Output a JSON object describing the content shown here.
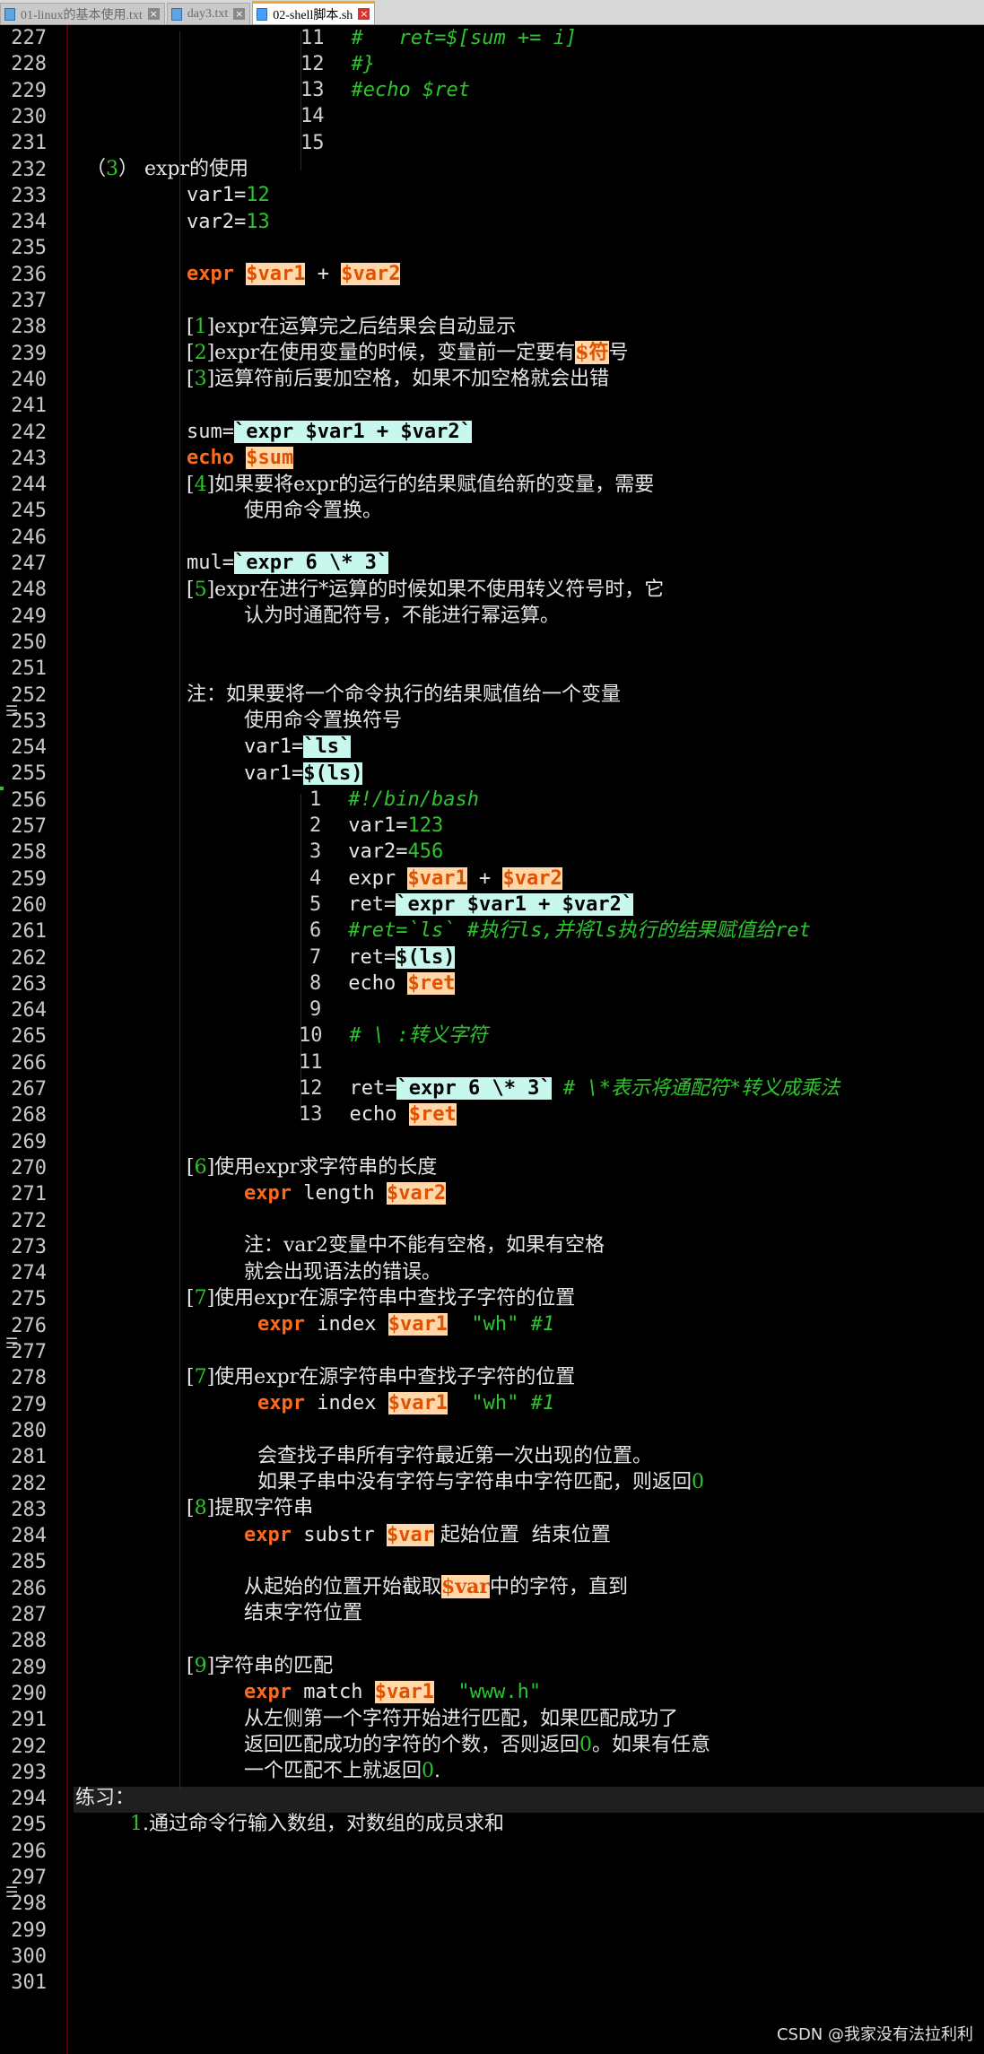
{
  "tabs": [
    {
      "label": "01-linux的基本使用.txt",
      "active": false
    },
    {
      "label": "day3.txt",
      "active": false
    },
    {
      "label": "02-shell脚本.sh",
      "active": true
    }
  ],
  "line_numbers": [
    "227",
    "228",
    "229",
    "230",
    "231",
    "232",
    "233",
    "234",
    "235",
    "236",
    "237",
    "238",
    "239",
    "240",
    "241",
    "242",
    "243",
    "244",
    "245",
    "246",
    "247",
    "248",
    "249",
    "250",
    "251",
    "252",
    "253",
    "254",
    "255",
    "256",
    "257",
    "258",
    "259",
    "260",
    "261",
    "262",
    "263",
    "264",
    "265",
    "266",
    "267",
    "268",
    "269",
    "270",
    "271",
    "272",
    "273",
    "274",
    "275",
    "276",
    "277",
    "278",
    "279",
    "280",
    "281",
    "282",
    "283",
    "284",
    "285",
    "286",
    "287",
    "288",
    "289",
    "290",
    "291",
    "292",
    "293",
    "294",
    "295",
    "296",
    "297",
    "298",
    "299",
    "300",
    "301"
  ],
  "lines": {
    "l227": {
      "n": "11",
      "a": "#   ret=$[sum += i]"
    },
    "l228": {
      "n": "12",
      "a": "#}"
    },
    "l229": {
      "n": "13",
      "a": "#echo $ret"
    },
    "l230": {
      "n": "14"
    },
    "l231": {
      "n": "15"
    },
    "l232": {
      "a": "（",
      "b": "3",
      "c": "） expr的使用"
    },
    "l233": {
      "a": "var1=",
      "b": "12"
    },
    "l234": {
      "a": "var2=",
      "b": "13"
    },
    "l236": {
      "a": "expr",
      "b": "$var1",
      "c": " + ",
      "d": "$var2"
    },
    "l238": {
      "a": "[",
      "b": "1",
      "c": "]expr在运算完之后结果会自动显示"
    },
    "l239": {
      "a": "[",
      "b": "2",
      "c": "]expr在使用变量的时候，变量前一定要有",
      "d": "$符",
      "e": "号"
    },
    "l240": {
      "a": "[",
      "b": "3",
      "c": "]运算符前后要加空格，如果不加空格就会出错"
    },
    "l242": {
      "a": "sum=",
      "b": "`expr $var1 + $var2`"
    },
    "l243": {
      "a": "echo",
      "b": "$sum"
    },
    "l244": {
      "a": "[",
      "b": "4",
      "c": "]如果要将expr的运行的结果赋值给新的变量，需要"
    },
    "l245": {
      "a": "使用命令置换。"
    },
    "l247": {
      "a": "mul=",
      "b": "`expr 6 \\* 3`"
    },
    "l248": {
      "a": "[",
      "b": "5",
      "c": "]expr在进行*运算的时候如果不使用转义符号时，它"
    },
    "l249": {
      "a": "认为时通配符号，不能进行幂运算。"
    },
    "l252": {
      "a": "注：如果要将一个命令执行的结果赋值给一个变量"
    },
    "l253": {
      "a": "使用命令置换符号"
    },
    "l254": {
      "a": "var1=",
      "b": "`ls`"
    },
    "l255": {
      "a": "var1=",
      "b": "$(ls)"
    },
    "l256": {
      "n": "1",
      "a": "#!/bin/bash"
    },
    "l257": {
      "n": "2",
      "a": "var1=",
      "b": "123"
    },
    "l258": {
      "n": "3",
      "a": "var2=",
      "b": "456"
    },
    "l259": {
      "n": "4",
      "a": "expr ",
      "b": "$var1",
      "c": " + ",
      "d": "$var2"
    },
    "l260": {
      "n": "5",
      "a": "ret=",
      "b": "`expr $var1 + $var2`"
    },
    "l261": {
      "n": "6",
      "a": "#ret=`ls` #执行ls,并将ls执行的结果赋值给ret"
    },
    "l262": {
      "n": "7",
      "a": "ret=",
      "b": "$(ls)"
    },
    "l263": {
      "n": "8",
      "a": "echo ",
      "b": "$ret"
    },
    "l264": {
      "n": "9"
    },
    "l265": {
      "n": "10",
      "a": "# \\ :转义字符"
    },
    "l266": {
      "n": "11"
    },
    "l267": {
      "n": "12",
      "a": "ret=",
      "b": "`expr 6 \\* 3`",
      "c": " # \\*表示将通配符*转义成乘法"
    },
    "l268": {
      "n": "13",
      "a": "echo ",
      "b": "$ret"
    },
    "l270": {
      "a": "[",
      "b": "6",
      "c": "]使用expr求字符串的长度"
    },
    "l271": {
      "a": "expr",
      "b": " length ",
      "c": "$var2"
    },
    "l273": {
      "a": "注：var2变量中不能有空格，如果有空格"
    },
    "l274": {
      "a": "就会出现语法的错误。"
    },
    "l275": {
      "a": "[",
      "b": "7",
      "c": "]使用expr在源字符串中查找子字符的位置"
    },
    "l276": {
      "a": "expr",
      "b": " index ",
      "c": "$var1",
      "d": "  \"wh\" ",
      "e": "#1"
    },
    "l278": {
      "a": "[",
      "b": "7",
      "c": "]使用expr在源字符串中查找子字符的位置"
    },
    "l279": {
      "a": "expr",
      "b": " index ",
      "c": "$var1",
      "d": "  \"wh\" ",
      "e": "#1"
    },
    "l281": {
      "a": "会查找子串所有字符最近第一次出现的位置。"
    },
    "l282": {
      "a": "如果子串中没有字符与字符串中字符匹配，则返回",
      "b": "0"
    },
    "l283": {
      "a": "[",
      "b": "8",
      "c": "]提取字符串"
    },
    "l284": {
      "a": "expr",
      "b": " substr ",
      "c": "$var",
      "d": " 起始位置  结束位置"
    },
    "l286": {
      "a": "从起始的位置开始截取",
      "b": "$var",
      "c": "中的字符，直到"
    },
    "l287": {
      "a": "结束字符位置"
    },
    "l289": {
      "a": "[",
      "b": "9",
      "c": "]字符串的匹配"
    },
    "l290": {
      "a": "expr",
      "b": " match ",
      "c": "$var1",
      "d": "  \"www.h\""
    },
    "l291": {
      "a": "从左侧第一个字符开始进行匹配，如果匹配成功了"
    },
    "l292": {
      "a": "返回匹配成功的字符的个数，否则返回",
      "b": "0",
      "c": "。如果有任意"
    },
    "l293": {
      "a": "一个匹配不上就返回",
      "b": "0",
      "c": "."
    },
    "l294": {
      "a": "练习："
    },
    "l295": {
      "a": "1",
      "b": ".通过命令行输入数组，对数组的成员求和"
    }
  },
  "watermark": "CSDN @我家没有法拉利利",
  "colors": {
    "background": "#000000",
    "comment": "#2ec42e",
    "keyword": "#ff6a1a",
    "var_highlight": "#ffd7a8",
    "backtick_highlight": "#c8f7ee"
  }
}
